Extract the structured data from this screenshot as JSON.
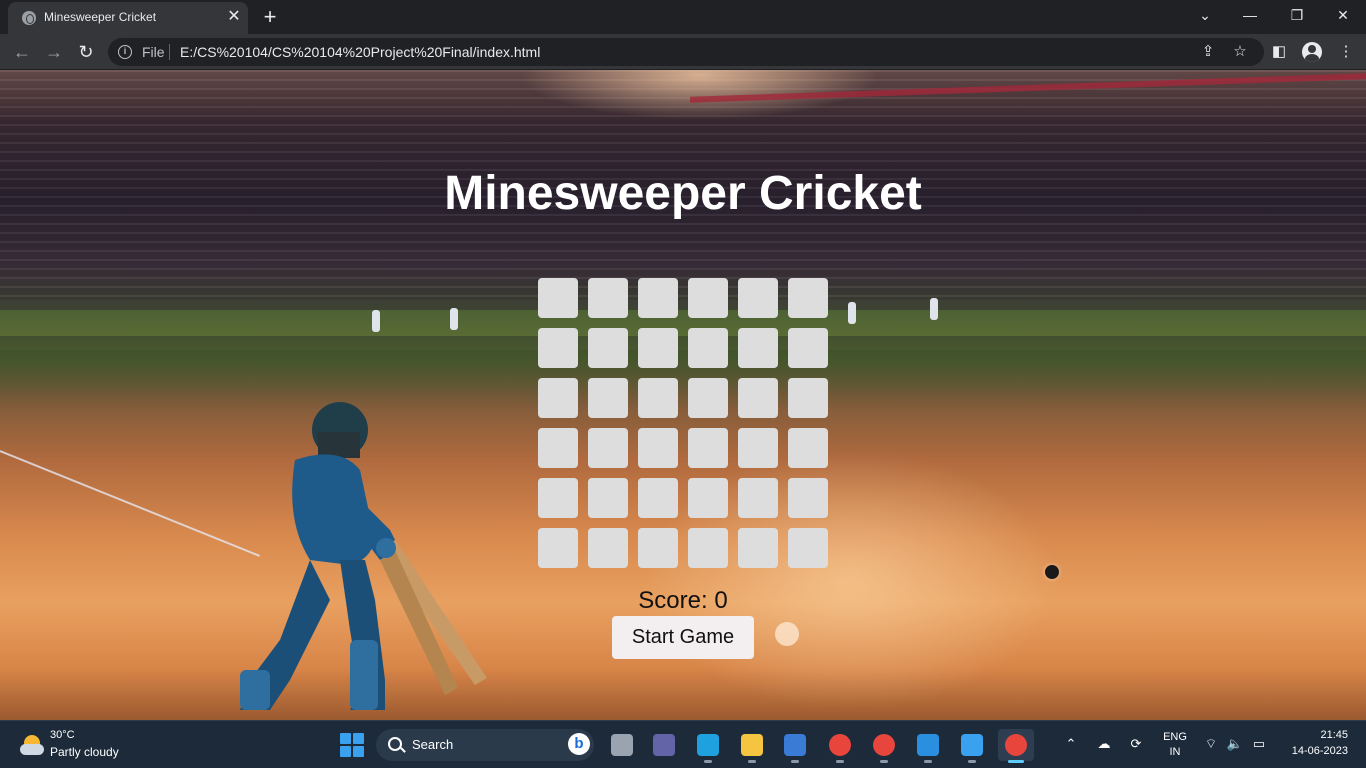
{
  "browser": {
    "tab_title": "Minesweeper Cricket",
    "tab_close": "✕",
    "new_tab": "+",
    "file_label": "File",
    "url": "E:/CS%20104/CS%20104%20Project%20Final/index.html",
    "window_controls": {
      "dropdown": "⌄",
      "minimize": "—",
      "restore": "❐",
      "close": "✕"
    }
  },
  "game": {
    "title": "Minesweeper Cricket",
    "grid": {
      "rows": 6,
      "columns": 6
    },
    "score_text": "Score: 0",
    "start_label": "Start Game"
  },
  "taskbar": {
    "weather_temp": "30°C",
    "weather_desc": "Partly cloudy",
    "search_placeholder": "Search",
    "lang_line1": "ENG",
    "lang_line2": "IN",
    "time": "21:45",
    "date": "14-06-2023",
    "apps": [
      {
        "name": "task-view",
        "color": "#9aa4b0"
      },
      {
        "name": "teams",
        "color": "#6264a7"
      },
      {
        "name": "edge",
        "color": "#1fa1e0"
      },
      {
        "name": "file-explorer",
        "color": "#f5c542"
      },
      {
        "name": "microsoft-store",
        "color": "#3a7bd5"
      },
      {
        "name": "chrome-profile-s",
        "color": "#e8453c"
      },
      {
        "name": "chrome-profile-2",
        "color": "#e8453c"
      },
      {
        "name": "vscode",
        "color": "#2b8fe0"
      },
      {
        "name": "photos",
        "color": "#3aa0f0"
      },
      {
        "name": "chrome",
        "color": "#e8453c"
      }
    ]
  },
  "colors": {
    "cell": "#dddddd",
    "button_bg": "#f3eef0",
    "title_text": "#ffffff",
    "chrome_dark": "#202124",
    "chrome_toolbar": "#35363a",
    "taskbar": "#1c2a3a"
  }
}
